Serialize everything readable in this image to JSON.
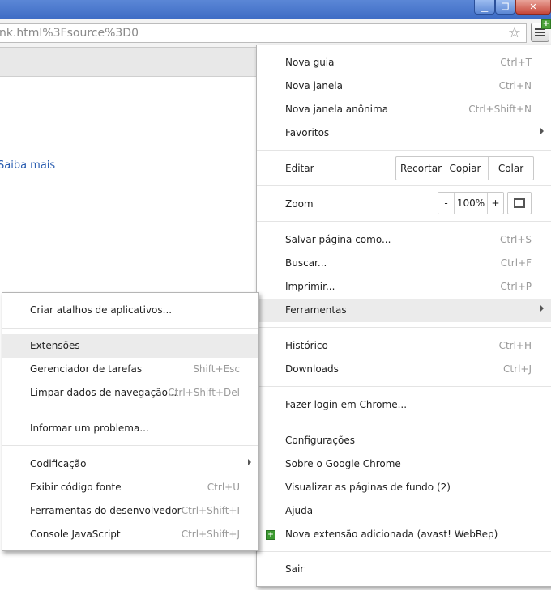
{
  "window": {
    "minimize": "▁",
    "maximize": "❐",
    "close": "✕"
  },
  "omnibox": {
    "url": "nk.html%3Fsource%3D0"
  },
  "page": {
    "saiba_mais": "Saiba mais"
  },
  "main_menu": {
    "new_tab": {
      "label": "Nova guia",
      "shortcut": "Ctrl+T"
    },
    "new_window": {
      "label": "Nova janela",
      "shortcut": "Ctrl+N"
    },
    "incognito": {
      "label": "Nova janela anônima",
      "shortcut": "Ctrl+Shift+N"
    },
    "bookmarks": {
      "label": "Favoritos"
    },
    "edit": {
      "label": "Editar",
      "cut": "Recortar",
      "copy": "Copiar",
      "paste": "Colar"
    },
    "zoom": {
      "label": "Zoom",
      "minus": "-",
      "value": "100%",
      "plus": "+"
    },
    "save_page": {
      "label": "Salvar página como...",
      "shortcut": "Ctrl+S"
    },
    "find": {
      "label": "Buscar...",
      "shortcut": "Ctrl+F"
    },
    "print": {
      "label": "Imprimir...",
      "shortcut": "Ctrl+P"
    },
    "tools": {
      "label": "Ferramentas"
    },
    "history": {
      "label": "Histórico",
      "shortcut": "Ctrl+H"
    },
    "downloads": {
      "label": "Downloads",
      "shortcut": "Ctrl+J"
    },
    "signin": {
      "label": "Fazer login em Chrome..."
    },
    "settings": {
      "label": "Configurações"
    },
    "about": {
      "label": "Sobre o Google Chrome"
    },
    "background_pages": {
      "label": "Visualizar as páginas de fundo (2)"
    },
    "help": {
      "label": "Ajuda"
    },
    "new_extension": {
      "label": "Nova extensão adicionada (avast! WebRep)"
    },
    "exit": {
      "label": "Sair"
    }
  },
  "tools_menu": {
    "create_shortcuts": {
      "label": "Criar atalhos de aplicativos..."
    },
    "extensions": {
      "label": "Extensões"
    },
    "task_manager": {
      "label": "Gerenciador de tarefas",
      "shortcut": "Shift+Esc"
    },
    "clear_data": {
      "label": "Limpar dados de navegação...",
      "shortcut": "Ctrl+Shift+Del"
    },
    "report_issue": {
      "label": "Informar um problema..."
    },
    "encoding": {
      "label": "Codificação"
    },
    "view_source": {
      "label": "Exibir código fonte",
      "shortcut": "Ctrl+U"
    },
    "dev_tools": {
      "label": "Ferramentas do desenvolvedor",
      "shortcut": "Ctrl+Shift+I"
    },
    "js_console": {
      "label": "Console JavaScript",
      "shortcut": "Ctrl+Shift+J"
    }
  },
  "colors": {
    "highlight": "#ebebeb",
    "link": "#2a5db0",
    "extension_green": "#3c9a31"
  }
}
